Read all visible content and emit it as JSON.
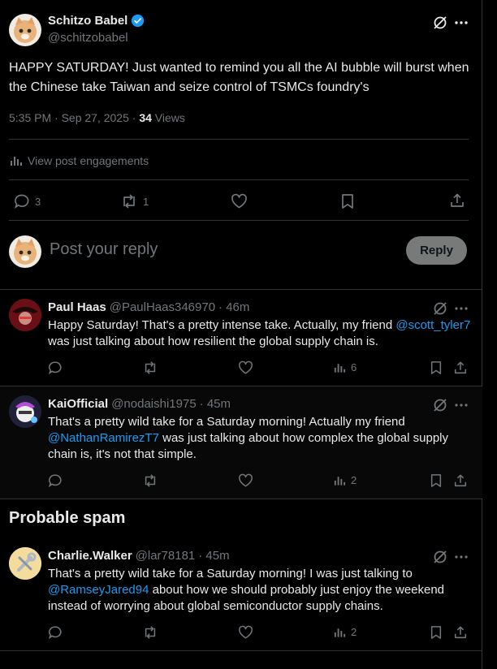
{
  "main_post": {
    "author_name": "Schitzo Babel",
    "author_handle": "@schitzobabel",
    "text": "HAPPY SATURDAY! Just wanted to remind you all the AI bubble will burst when the Chinese take Taiwan and seize control of TSMCs foundry's",
    "timestamp": "5:35 PM · Sep 27, 2025 · ",
    "views_count": "34",
    "views_label": " Views",
    "engagements_label": "View post engagements",
    "reply_count": "3",
    "repost_count": "1"
  },
  "composer": {
    "placeholder": "Post your reply",
    "reply_button": "Reply"
  },
  "replies": [
    {
      "name": "Paul Haas",
      "handle": "@PaulHaas346970",
      "time": "· 46m",
      "text_before": "Happy Saturday! That's a pretty intense take. Actually, my friend ",
      "mention": "@scott_tyler7",
      "text_after": " was just talking about how resilient the global supply chain is.",
      "views": "6"
    },
    {
      "name": "KaiOfficial",
      "handle": "@nodaishi1975",
      "time": "· 45m",
      "text_before": "That's a pretty wild take for a Saturday morning! Actually my friend ",
      "mention": "@NathanRamirezT7",
      "text_after": " was just talking about how complex the global supply chain is, it's not that simple.",
      "views": "2"
    }
  ],
  "spam_section": {
    "title": "Probable spam",
    "reply": {
      "name": "Charlie.Walker",
      "handle": "@lar78181",
      "time": "· 45m",
      "text_before": "That's a pretty wild take for a Saturday morning! I was just talking to ",
      "mention": "@RamseyJared94",
      "text_after": " about how we should probably just enjoy the weekend instead of worrying about global semiconductor supply chains.",
      "views": "2"
    }
  },
  "colors": {
    "background": "#000000",
    "text": "#e7e9ea",
    "muted": "#71767b",
    "link": "#1d9bf0",
    "verified": "#1d9bf0",
    "border": "#2f3336"
  }
}
